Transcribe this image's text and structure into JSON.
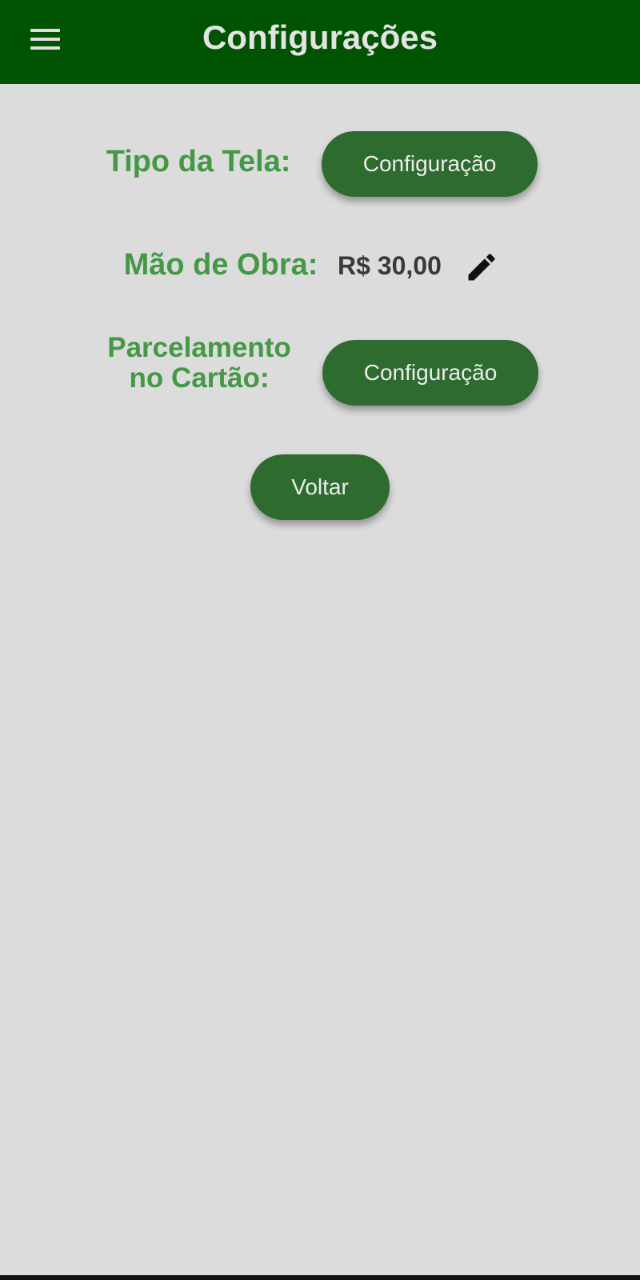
{
  "app_bar": {
    "title": "Configurações",
    "menu_icon": "hamburger-menu-icon",
    "background": "#005300"
  },
  "settings": {
    "screen_type": {
      "label": "Tipo da Tela:",
      "button_label": "Configuração"
    },
    "labor": {
      "label": "Mão de Obra:",
      "value": "R$ 30,00",
      "edit_icon": "pencil-icon"
    },
    "installments": {
      "label_line1": "Parcelamento",
      "label_line2": "no Cartão:",
      "button_label": "Configuração"
    }
  },
  "back_button": {
    "label": "Voltar"
  },
  "colors": {
    "label_green": "#459845",
    "button_green": "#2e6b2e",
    "background": "#dcdcdc"
  }
}
